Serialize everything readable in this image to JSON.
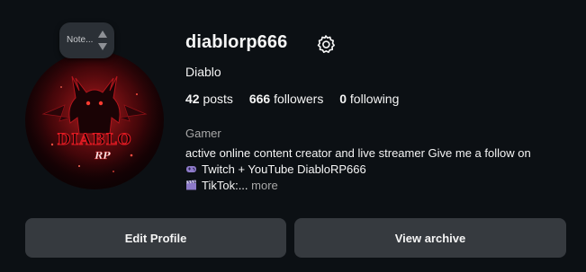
{
  "profile": {
    "username": "diablorp666",
    "display_name": "Diablo",
    "avatar_logo_text": "DIABLO RP",
    "note_text": "Note..."
  },
  "stats": {
    "posts_count": "42",
    "posts_label": "posts",
    "followers_count": "666",
    "followers_label": "followers",
    "following_count": "0",
    "following_label": "following"
  },
  "bio": {
    "category": "Gamer",
    "line1": "active online content creator and live streamer Give me a follow on",
    "line2": "Twitch + YouTube DiabloRP666",
    "line3": "TikTok:...",
    "more_label": "more",
    "line2_icon": "video-game-icon",
    "line3_icon": "clapper-icon"
  },
  "buttons": {
    "edit_profile": "Edit Profile",
    "view_archive": "View archive"
  },
  "icons": {
    "settings": "gear-icon",
    "note_arrows": "sort-arrows-icon"
  },
  "colors": {
    "background": "#0c1014",
    "button": "#363a3f",
    "secondary_text": "#a8a8a8",
    "avatar_accent": "#d9141e"
  }
}
